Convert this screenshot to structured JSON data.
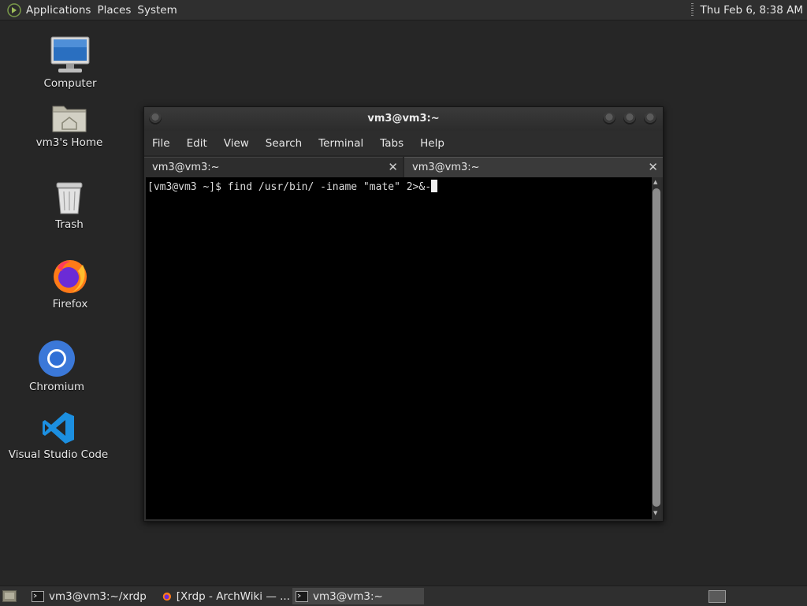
{
  "top_panel": {
    "menus": [
      "Applications",
      "Places",
      "System"
    ],
    "clock": "Thu Feb  6,  8:38 AM"
  },
  "desktop": {
    "icons": [
      {
        "label": "Computer",
        "icon": "computer-icon"
      },
      {
        "label": "vm3's Home",
        "icon": "home-folder-icon"
      },
      {
        "label": "Trash",
        "icon": "trash-icon"
      },
      {
        "label": "Firefox",
        "icon": "firefox-icon"
      },
      {
        "label": "Chromium",
        "icon": "chromium-icon"
      },
      {
        "label": "Visual Studio Code",
        "icon": "vscode-icon"
      }
    ]
  },
  "terminal": {
    "title": "vm3@vm3:~",
    "menu": [
      "File",
      "Edit",
      "View",
      "Search",
      "Terminal",
      "Tabs",
      "Help"
    ],
    "tabs": [
      {
        "label": "vm3@vm3:~",
        "active": true
      },
      {
        "label": "vm3@vm3:~",
        "active": false
      }
    ],
    "close_glyph": "✕",
    "command_line": "[vm3@vm3 ~]$ find /usr/bin/ -iname \"mate\" 2>&-"
  },
  "taskbar": {
    "tasks": [
      {
        "label": "vm3@vm3:~/xrdp",
        "icon": "terminal-icon",
        "active": false
      },
      {
        "label": "[Xrdp - ArchWiki — ...",
        "icon": "firefox-icon",
        "active": false
      },
      {
        "label": "vm3@vm3:~",
        "icon": "terminal-icon",
        "active": true
      }
    ]
  },
  "colors": {
    "desktop_bg": "#262626",
    "panel_bg": "#2f2f2f",
    "terminal_bg": "#000000",
    "terminal_fg": "#dcdcdc"
  }
}
